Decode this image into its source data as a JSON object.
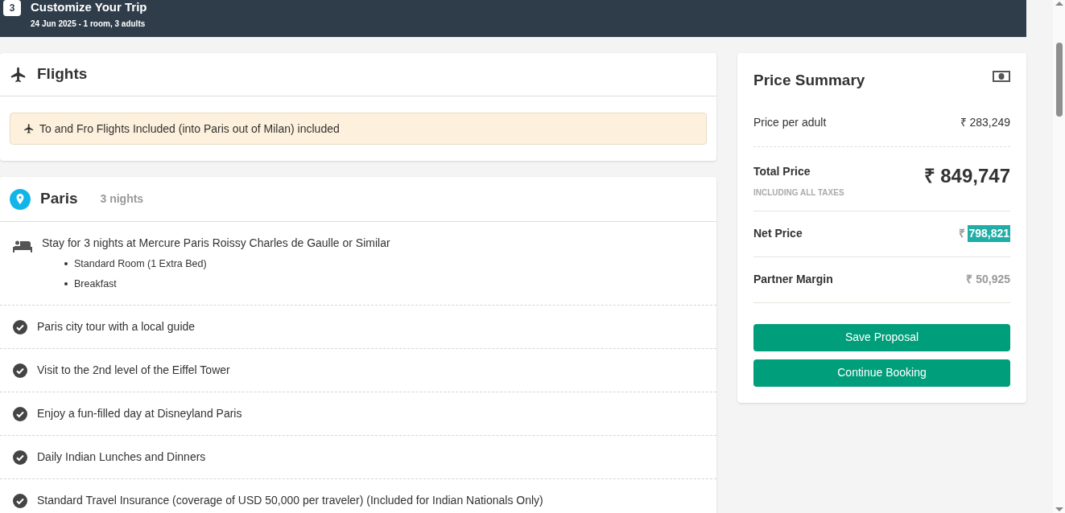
{
  "header": {
    "step": "3",
    "title": "Customize Your Trip",
    "subtitle": "24 Jun 2025 - 1 room, 3 adults"
  },
  "flights": {
    "title": "Flights",
    "notice": "To and Fro Flights Included (into Paris out of Milan) included"
  },
  "city": {
    "name": "Paris",
    "nights": "3 nights",
    "items": [
      {
        "kind": "hotel",
        "text": "Stay for 3 nights at Mercure Paris Roissy Charles de Gaulle or Similar",
        "details": [
          "Standard Room (1 Extra Bed)",
          "Breakfast"
        ]
      },
      {
        "kind": "check",
        "text": "Paris city tour with a local guide"
      },
      {
        "kind": "check",
        "text": "Visit to the 2nd level of the Eiffel Tower"
      },
      {
        "kind": "check",
        "text": "Enjoy a fun-filled day at Disneyland Paris"
      },
      {
        "kind": "check",
        "text": "Daily Indian Lunches and Dinners"
      },
      {
        "kind": "check",
        "text": "Standard Travel Insurance (coverage of USD 50,000 per traveler) (Included for Indian Nationals Only)"
      }
    ]
  },
  "price_summary": {
    "title": "Price Summary",
    "per_adult": {
      "label": "Price per adult",
      "value": "₹ 283,249"
    },
    "total": {
      "label": "Total Price",
      "note": "INCLUDING ALL TAXES",
      "value": "₹ 849,747"
    },
    "net": {
      "label": "Net Price",
      "currency": "₹",
      "amount": "798,821",
      "highlighted": true
    },
    "margin": {
      "label": "Partner Margin",
      "value": "₹ 50,925"
    },
    "buttons": [
      "Save Proposal",
      "Continue Booking"
    ]
  }
}
